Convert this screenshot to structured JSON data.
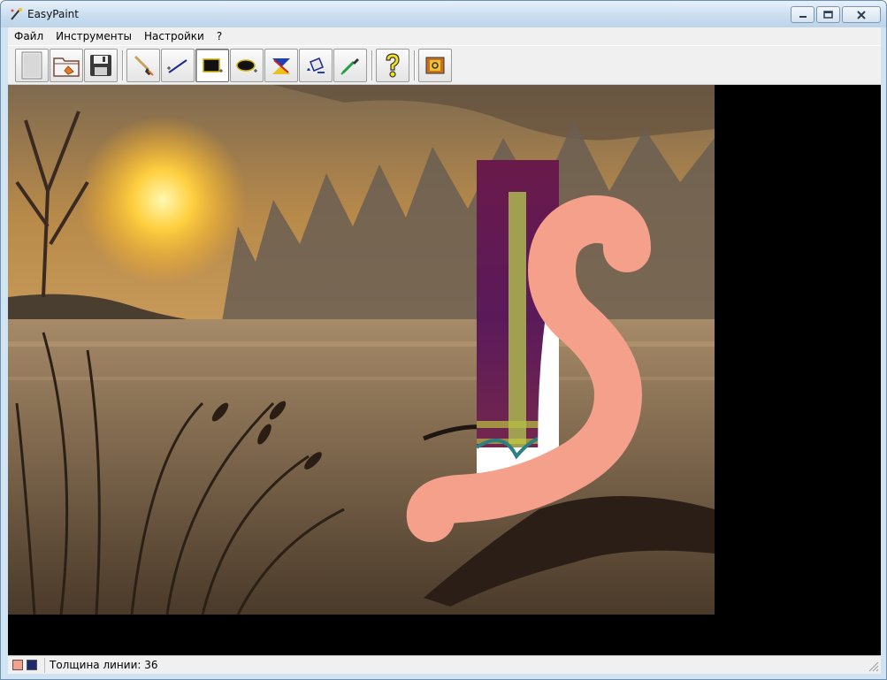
{
  "window": {
    "title": "EasyPaint"
  },
  "menu": {
    "items": [
      "Файл",
      "Инструменты",
      "Настройки",
      "?"
    ]
  },
  "toolbar": {
    "tools": [
      {
        "icon": "new-file-icon",
        "active": false
      },
      {
        "icon": "open-folder-icon",
        "active": false
      },
      {
        "icon": "save-disk-icon",
        "active": false
      },
      {
        "icon": "brush-icon",
        "active": false
      },
      {
        "icon": "line-icon",
        "active": false
      },
      {
        "icon": "rectangle-icon",
        "active": true
      },
      {
        "icon": "ellipse-icon",
        "active": false
      },
      {
        "icon": "eraser-icon",
        "active": false
      },
      {
        "icon": "fill-bucket-icon",
        "active": false
      },
      {
        "icon": "color-picker-icon",
        "active": false
      },
      {
        "icon": "help-icon",
        "active": false
      },
      {
        "icon": "settings-icon",
        "active": false
      }
    ]
  },
  "colors": {
    "primary": "#f4a08a",
    "secondary": "#1e2a6e",
    "chrome_blue": "#cfe3f3"
  },
  "status": {
    "line_width_text": "Толщина линии: 36"
  }
}
